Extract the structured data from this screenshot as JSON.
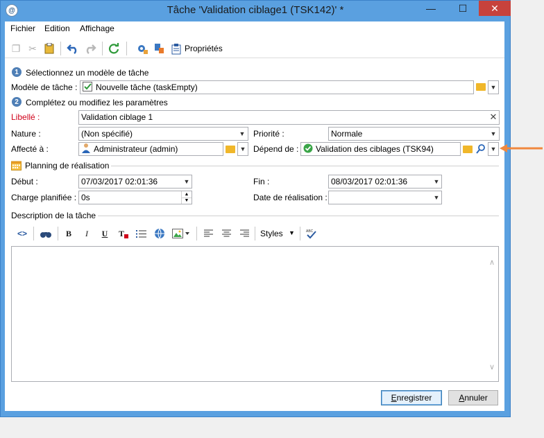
{
  "window": {
    "title": "Tâche 'Validation ciblage1 (TSK142)' *",
    "minimize": "—",
    "maximize": "☐",
    "close": "✕",
    "app_icon": "@"
  },
  "menu": [
    "Fichier",
    "Edition",
    "Affichage"
  ],
  "toolbar": {
    "properties_label": "Propriétés"
  },
  "step1": {
    "number": "1",
    "title": "Sélectionnez un modèle de tâche",
    "template_label": "Modèle de tâche :",
    "template_value": "Nouvelle tâche (taskEmpty)"
  },
  "step2": {
    "number": "2",
    "title": "Complétez ou modifiez les paramètres"
  },
  "fields": {
    "libelle_label": "Libellé :",
    "libelle_value": "Validation ciblage 1",
    "nature_label": "Nature :",
    "nature_value": "(Non spécifié)",
    "priorite_label": "Priorité :",
    "priorite_value": "Normale",
    "affecte_label": "Affecté à :",
    "affecte_value": "Administrateur (admin)",
    "depend_label": "Dépend de :",
    "depend_value": "Validation des ciblages (TSK94)"
  },
  "planning": {
    "title": "Planning de réalisation",
    "debut_label": "Début :",
    "debut_value": "07/03/2017 02:01:36",
    "fin_label": "Fin :",
    "fin_value": "08/03/2017 02:01:36",
    "charge_label": "Charge planifiée :",
    "charge_value": "0s",
    "date_real_label": "Date de réalisation :",
    "date_real_value": ""
  },
  "description": {
    "title": "Description de la tâche",
    "styles_label": "Styles",
    "content": ""
  },
  "buttons": {
    "save_prefix": "E",
    "save_rest": "nregistrer",
    "cancel_prefix": "A",
    "cancel_rest": "nnuler"
  },
  "colors": {
    "required_label": "#d0021b",
    "step_badge": "#4f7fb6",
    "annotation_arrow": "#f0883e",
    "titlebar": "#5aa0e0",
    "close_button": "#c7423c"
  }
}
